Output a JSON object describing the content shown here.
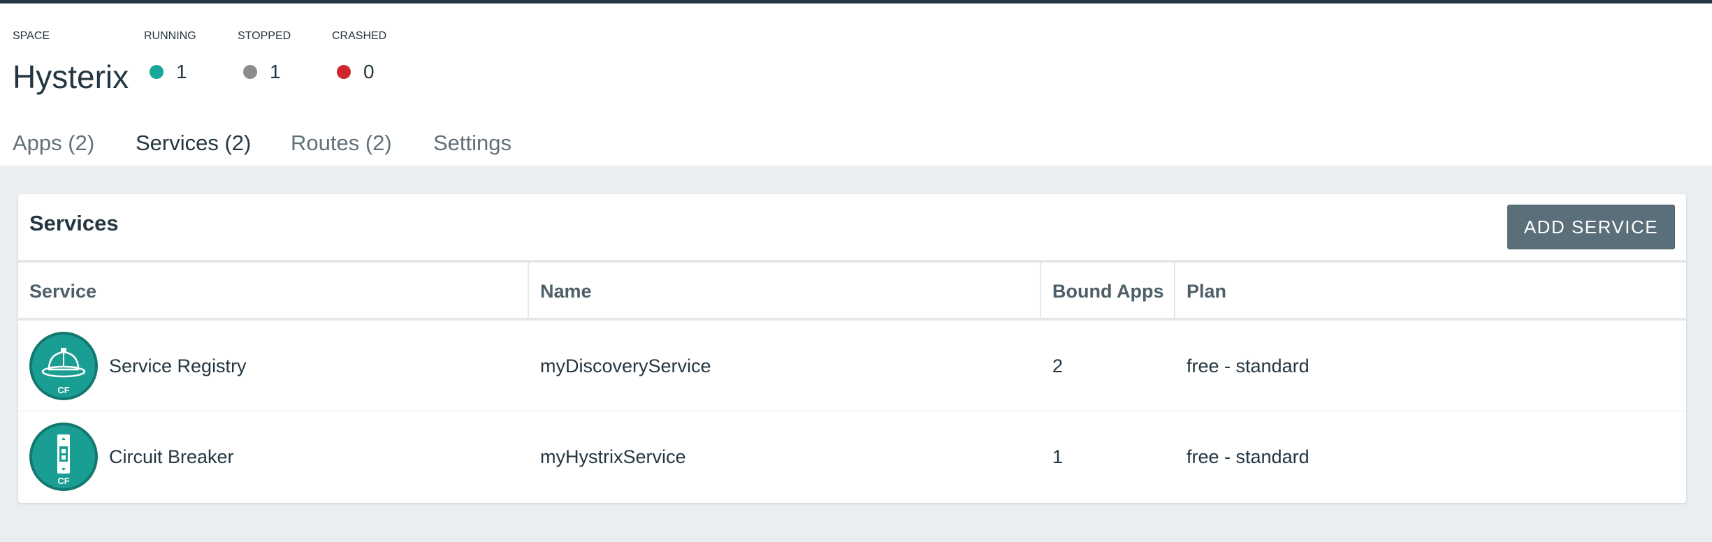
{
  "header": {
    "space_label": "SPACE",
    "space_name": "Hysterix",
    "stats": [
      {
        "label": "RUNNING",
        "value": "1",
        "color": "#17a79b"
      },
      {
        "label": "STOPPED",
        "value": "1",
        "color": "#8c8c8c"
      },
      {
        "label": "CRASHED",
        "value": "0",
        "color": "#d0262f"
      }
    ]
  },
  "tabs": [
    {
      "label": "Apps (2)",
      "active": false
    },
    {
      "label": "Services (2)",
      "active": true
    },
    {
      "label": "Routes (2)",
      "active": false
    },
    {
      "label": "Settings",
      "active": false
    }
  ],
  "services_card": {
    "title": "Services",
    "add_button_label": "ADD SERVICE",
    "columns": [
      "Service",
      "Name",
      "Bound Apps",
      "Plan"
    ],
    "rows": [
      {
        "service": "Service Registry",
        "icon": "hard-hat-icon",
        "icon_badge": "CF",
        "name": "myDiscoveryService",
        "bound_apps": "2",
        "plan": "free - standard"
      },
      {
        "service": "Circuit Breaker",
        "icon": "circuit-breaker-icon",
        "icon_badge": "CF",
        "name": "myHystrixService",
        "bound_apps": "1",
        "plan": "free - standard"
      }
    ]
  },
  "colors": {
    "accent": "#1a9e94",
    "button": "#5b6f7a",
    "background": "#ebeef0"
  }
}
